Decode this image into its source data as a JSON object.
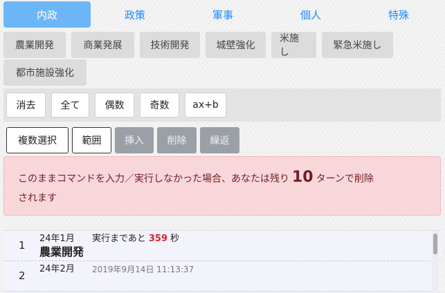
{
  "tabs": [
    "内政",
    "政策",
    "軍事",
    "個人",
    "特殊"
  ],
  "commands": [
    "農業開発",
    "商業発展",
    "技術開発",
    "城壁強化",
    "米施し",
    "緊急米施し",
    "都市施設強化"
  ],
  "selection": [
    "消去",
    "全て",
    "偶数",
    "奇数",
    "ax+b"
  ],
  "actions": {
    "multi_select": "複数選択",
    "range": "範囲",
    "insert": "挿入",
    "delete": "削除",
    "repeat": "繰返"
  },
  "alert": {
    "before": "このままコマンドを入力／実行しなかった場合、あなたは残り",
    "turns": "10",
    "after": "ターンで削除",
    "line2": "されます"
  },
  "rows": [
    {
      "num": "1",
      "turn": "24年1月",
      "remain_prefix": "実行まであと",
      "seconds": "359",
      "remain_suffix": "秒",
      "title": "農業開発"
    },
    {
      "num": "2",
      "turn": "24年2月",
      "date": "2019年9月14日 11:13:37"
    }
  ],
  "colors": {
    "accent": "#6cb6f7",
    "link": "#1a8cff",
    "alert_bg": "#f8d7da",
    "alert_text": "#721c24",
    "countdown": "#d9232d"
  }
}
